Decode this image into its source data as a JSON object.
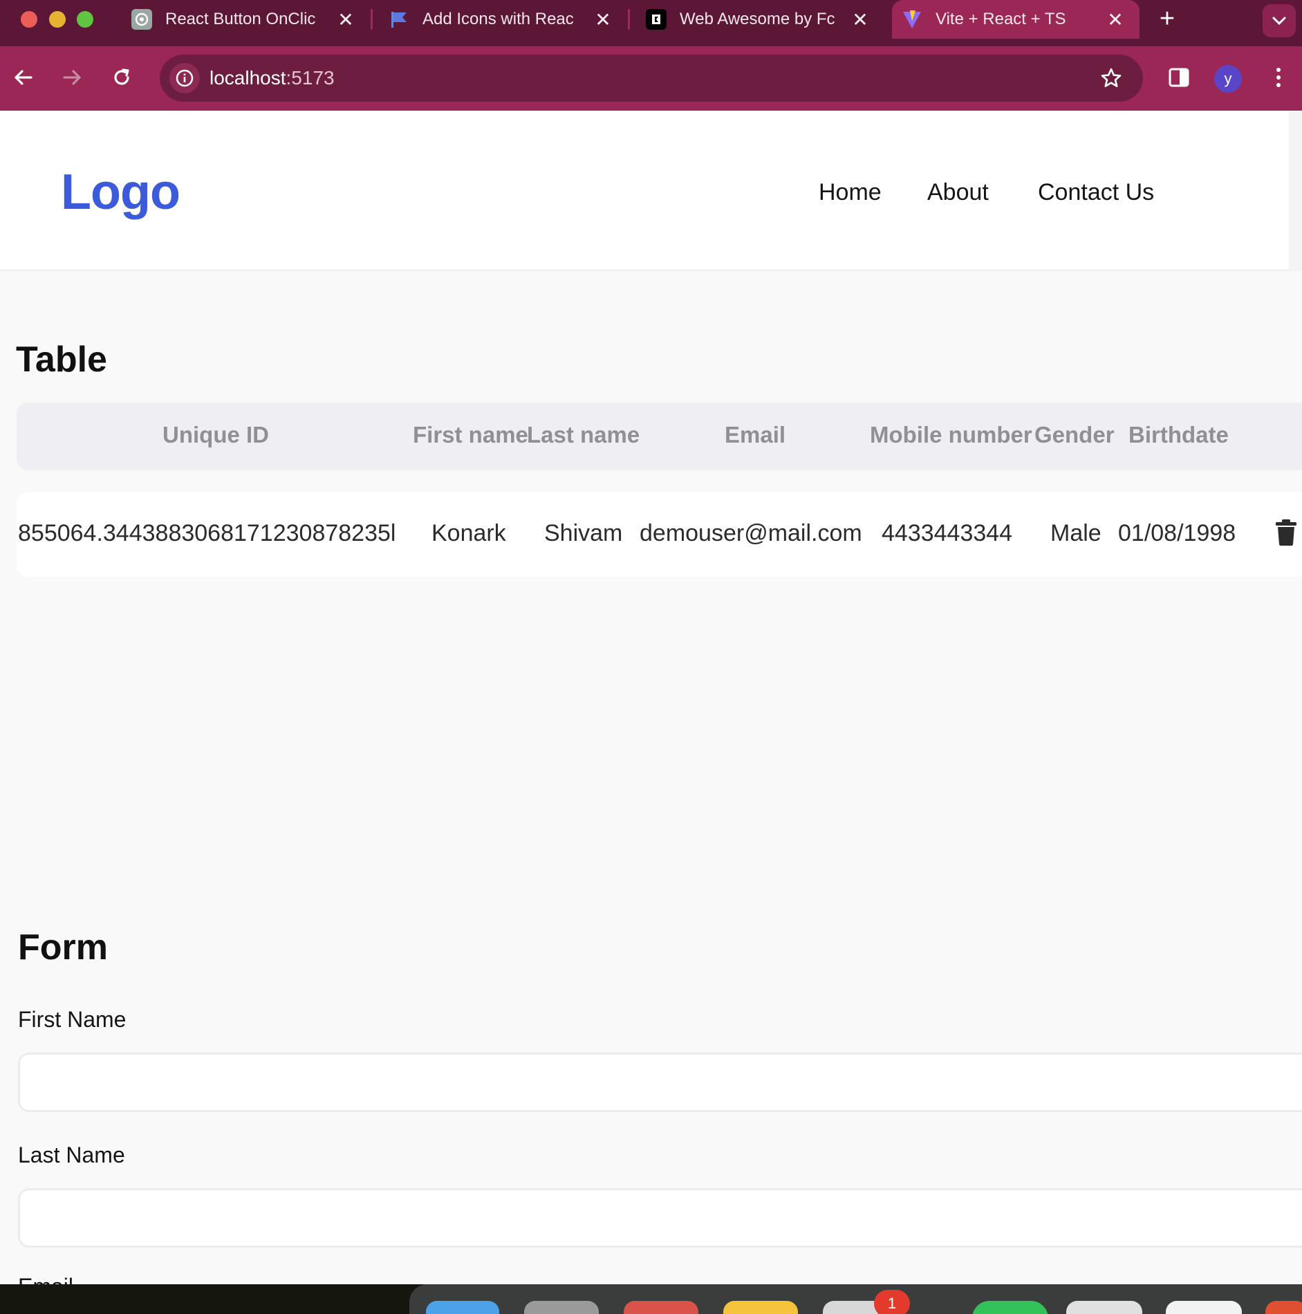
{
  "browser": {
    "tabs": [
      {
        "title": "React Button OnClic",
        "favicon": "chatgpt-icon",
        "active": false
      },
      {
        "title": "Add Icons with Reac",
        "favicon": "flag-icon",
        "active": false
      },
      {
        "title": "Web Awesome by Fc",
        "favicon": "font-awesome-icon",
        "active": false
      },
      {
        "title": "Vite + React + TS",
        "favicon": "vite-icon",
        "active": true
      }
    ],
    "close_glyph": "✕",
    "new_tab_glyph": "+",
    "address": {
      "host": "localhost",
      "port": ":5173"
    },
    "profile_initial": "y",
    "colors": {
      "tabbar": "#5c1636",
      "toolbar": "#9b2757",
      "omnibox": "#6d1d40"
    }
  },
  "navbar": {
    "logo": "Logo",
    "links": [
      "Home",
      "About",
      "Contact Us"
    ],
    "logo_color": "#3b5bdb"
  },
  "table": {
    "title": "Table",
    "columns": [
      "Unique ID",
      "First name",
      "Last name",
      "Email",
      "Mobile number",
      "Gender",
      "Birthdate"
    ],
    "rows": [
      {
        "unique_id": "855064.3443883068171230878235l",
        "first_name": "Konark",
        "last_name": "Shivam",
        "email": "demouser@mail.com",
        "mobile": "4433443344",
        "gender": "Male",
        "birthdate": "01/08/1998",
        "action_icon": "trash-icon"
      }
    ]
  },
  "form": {
    "title": "Form",
    "fields": [
      {
        "label": "First Name",
        "value": ""
      },
      {
        "label": "Last Name",
        "value": ""
      },
      {
        "label": "Email",
        "value": ""
      }
    ]
  },
  "dock": {
    "badge_count": "1"
  }
}
